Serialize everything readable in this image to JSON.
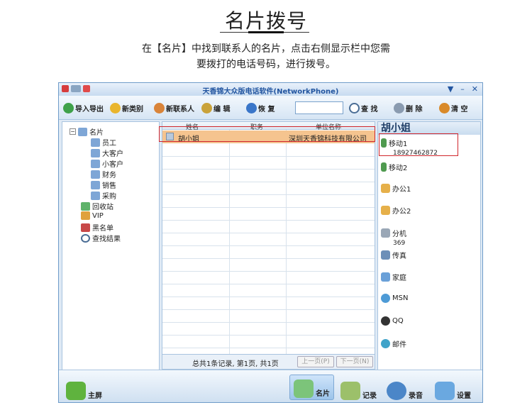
{
  "page": {
    "title": "名片拨号",
    "intro_line1": "在【名片】中找到联系人的名片，点击右侧显示栏中您需",
    "intro_line2": "要拨打的电话号码，进行拨号。"
  },
  "window": {
    "title": "天香锦大众版电话软件(NetworkPhone)",
    "controls": [
      "▼",
      "–",
      "✕"
    ]
  },
  "toolbar": {
    "import_export": "导入导出",
    "new_category": "新类别",
    "new_contact": "新联系人",
    "edit": "编  辑",
    "restore": "恢  复",
    "search_value": "",
    "find": "查  找",
    "delete": "删  除",
    "clear": "清  空"
  },
  "tree": {
    "root": "名片",
    "children": [
      "员工",
      "大客户",
      "小客户",
      "财务",
      "销售",
      "采购"
    ],
    "others": [
      "回收站",
      "VIP",
      "黑名单",
      "查找结果"
    ]
  },
  "grid": {
    "headers": [
      "姓名",
      "职务",
      "单位名称"
    ],
    "rows": [
      {
        "name": "胡小姐",
        "title": "",
        "company": "深圳天香锦科技有限公司"
      }
    ],
    "footer": "总共1条记录, 第1页, 共1页",
    "prev_page": "上一页(P)",
    "next_page": "下一页(N)"
  },
  "detail": {
    "name": "胡小姐",
    "mobile1_label": "移动1",
    "mobile1_value": "18927462872",
    "mobile2_label": "移动2",
    "office1_label": "办公1",
    "office2_label": "办公2",
    "ext_label": "分机",
    "ext_value": "369",
    "fax_label": "传真",
    "home_label": "家庭",
    "msn_label": "MSN",
    "qq_label": "QQ",
    "email_label": "邮件"
  },
  "bottom_nav": {
    "home": "主屏",
    "cards": "名片",
    "records": "记录",
    "recording": "录音",
    "settings": "设置"
  },
  "colors": {
    "highlight": "#d0262c",
    "selected_row": "#f5c48f",
    "title_text": "#2255a0"
  }
}
